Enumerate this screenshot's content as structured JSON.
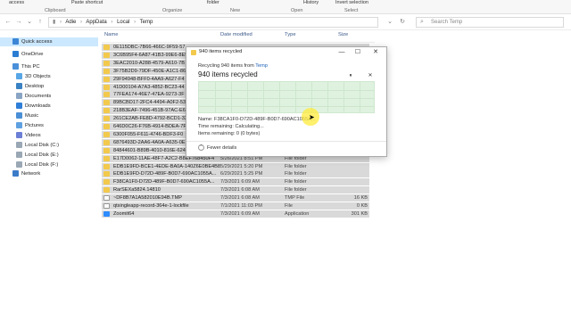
{
  "ribbon": {
    "access": "access",
    "paste_shortcut": "Paste shortcut",
    "folder": "folder",
    "history": "History",
    "invert_selection": "Invert selection",
    "groups": [
      "Clipboard",
      "Organize",
      "New",
      "Open",
      "Select"
    ]
  },
  "address": {
    "path": [
      "Adie",
      "AppData",
      "Local",
      "Temp"
    ],
    "search_placeholder": "Search Temp"
  },
  "sidebar": {
    "items": [
      {
        "label": "Quick access",
        "icon": "star-icon"
      },
      {
        "label": "OneDrive",
        "icon": "cloud-icon"
      },
      {
        "label": "This PC",
        "icon": "computer-icon"
      },
      {
        "label": "3D Objects",
        "icon": "cube-icon"
      },
      {
        "label": "Desktop",
        "icon": "desktop-icon"
      },
      {
        "label": "Documents",
        "icon": "document-icon"
      },
      {
        "label": "Downloads",
        "icon": "download-icon"
      },
      {
        "label": "Music",
        "icon": "music-icon"
      },
      {
        "label": "Pictures",
        "icon": "picture-icon"
      },
      {
        "label": "Videos",
        "icon": "video-icon"
      },
      {
        "label": "Local Disk (C:)",
        "icon": "drive-icon"
      },
      {
        "label": "Local Disk (E:)",
        "icon": "drive-icon"
      },
      {
        "label": "Local Disk (F:)",
        "icon": "drive-icon"
      },
      {
        "label": "Network",
        "icon": "network-icon"
      }
    ]
  },
  "columns": {
    "name": "Name",
    "date": "Date modified",
    "type": "Type",
    "size": "Size"
  },
  "files": [
    {
      "name": "0E115DBC-7B66-466C-9F59-57",
      "date": "",
      "type": "",
      "size": "",
      "kind": "folder"
    },
    {
      "name": "3C6B95F4-6A87-41B3-99E6-8E5",
      "date": "",
      "type": "",
      "size": "",
      "kind": "folder"
    },
    {
      "name": "3EAC2010-A288-4579-A610-7B",
      "date": "",
      "type": "",
      "size": "",
      "kind": "folder"
    },
    {
      "name": "3F75B2D9-79DF-450E-A1C1-86",
      "date": "",
      "type": "",
      "size": "",
      "kind": "folder"
    },
    {
      "name": "29F94948-BFF0-4AA9-A627-F4",
      "date": "",
      "type": "",
      "size": "",
      "kind": "folder"
    },
    {
      "name": "41D00104-A7A3-4852-BC23-44",
      "date": "",
      "type": "",
      "size": "",
      "kind": "folder"
    },
    {
      "name": "77FEA174-46E7-47EA-9273-3F",
      "date": "",
      "type": "",
      "size": "",
      "kind": "folder"
    },
    {
      "name": "89BCBD17-2FC4-4494-A0F2-53",
      "date": "",
      "type": "",
      "size": "",
      "kind": "folder"
    },
    {
      "name": "218B3EAF-7496-451B-97AC-E6",
      "date": "",
      "type": "",
      "size": "",
      "kind": "folder"
    },
    {
      "name": "261CE2AB-FE8D-4792-BCD1-32",
      "date": "",
      "type": "",
      "size": "",
      "kind": "folder"
    },
    {
      "name": "646D0C26-F76B-4914-BDEA-7F",
      "date": "",
      "type": "",
      "size": "",
      "kind": "folder"
    },
    {
      "name": "6300F055-F611-4746-BDF3-F0",
      "date": "",
      "type": "",
      "size": "",
      "kind": "folder"
    },
    {
      "name": "6876493D-2AA6-4A0A-A635-0E",
      "date": "",
      "type": "",
      "size": "",
      "kind": "folder"
    },
    {
      "name": "84844601-B89B-4010-816E-624",
      "date": "",
      "type": "",
      "size": "",
      "kind": "folder"
    },
    {
      "name": "E17D0062-11AE-48F7-A2C2-B8EF768450F4",
      "date": "5/26/2021 8:51 PM",
      "type": "File folder",
      "size": "",
      "kind": "folder"
    },
    {
      "name": "EDB1E9FD-BCE1-4EDE-BA0A-140Z6E0BE4B8",
      "date": "5/29/2021 5:20 PM",
      "type": "File folder",
      "size": "",
      "kind": "folder"
    },
    {
      "name": "EDB1E9FD-D72D-489F-B0D7-690AC1055A...",
      "date": "6/29/2021 5:25 PM",
      "type": "File folder",
      "size": "",
      "kind": "folder"
    },
    {
      "name": "F38CA1F0-D72D-489F-B0D7-690AC1055A...",
      "date": "7/3/2021 6:09 AM",
      "type": "File folder",
      "size": "",
      "kind": "folder"
    },
    {
      "name": "RarSEXa5824.14810",
      "date": "7/3/2021 6:08 AM",
      "type": "File folder",
      "size": "",
      "kind": "folder"
    },
    {
      "name": "~DF8B7A1A582010E94B.TMP",
      "date": "7/3/2021 6:08 AM",
      "type": "TMP File",
      "size": "16 KB",
      "kind": "doc"
    },
    {
      "name": "qtsingleapp-record-364e-1-lockfile",
      "date": "7/1/2021 11:03 PM",
      "type": "File",
      "size": "0 KB",
      "kind": "doc"
    },
    {
      "name": "Zoomit64",
      "date": "7/3/2021 6:09 AM",
      "type": "Application",
      "size": "301 KB",
      "kind": "app"
    }
  ],
  "dialog": {
    "title": "940 items recycled",
    "subtitle_prefix": "Recycling 940 items from",
    "subtitle_link": "Temp",
    "headline": "940 items recycled",
    "pause_symbol": "⏸",
    "close_symbol": "✕",
    "minimize_symbol": "—",
    "maximize_symbol": "☐",
    "name_line": "Name: F38CA1F0-D72D-489F-B0D7-690AC1055A...",
    "time_line": "Time remaining: Calculating...",
    "items_line": "Items remaining: 0 (0 bytes)",
    "fewer_details": "Fewer details",
    "progress": 1.0
  },
  "colors": {
    "selection": "#d9d9d9",
    "graph_bg": "#e9f7e9",
    "link": "#1a5fb4",
    "folder": "#f2c94c"
  }
}
